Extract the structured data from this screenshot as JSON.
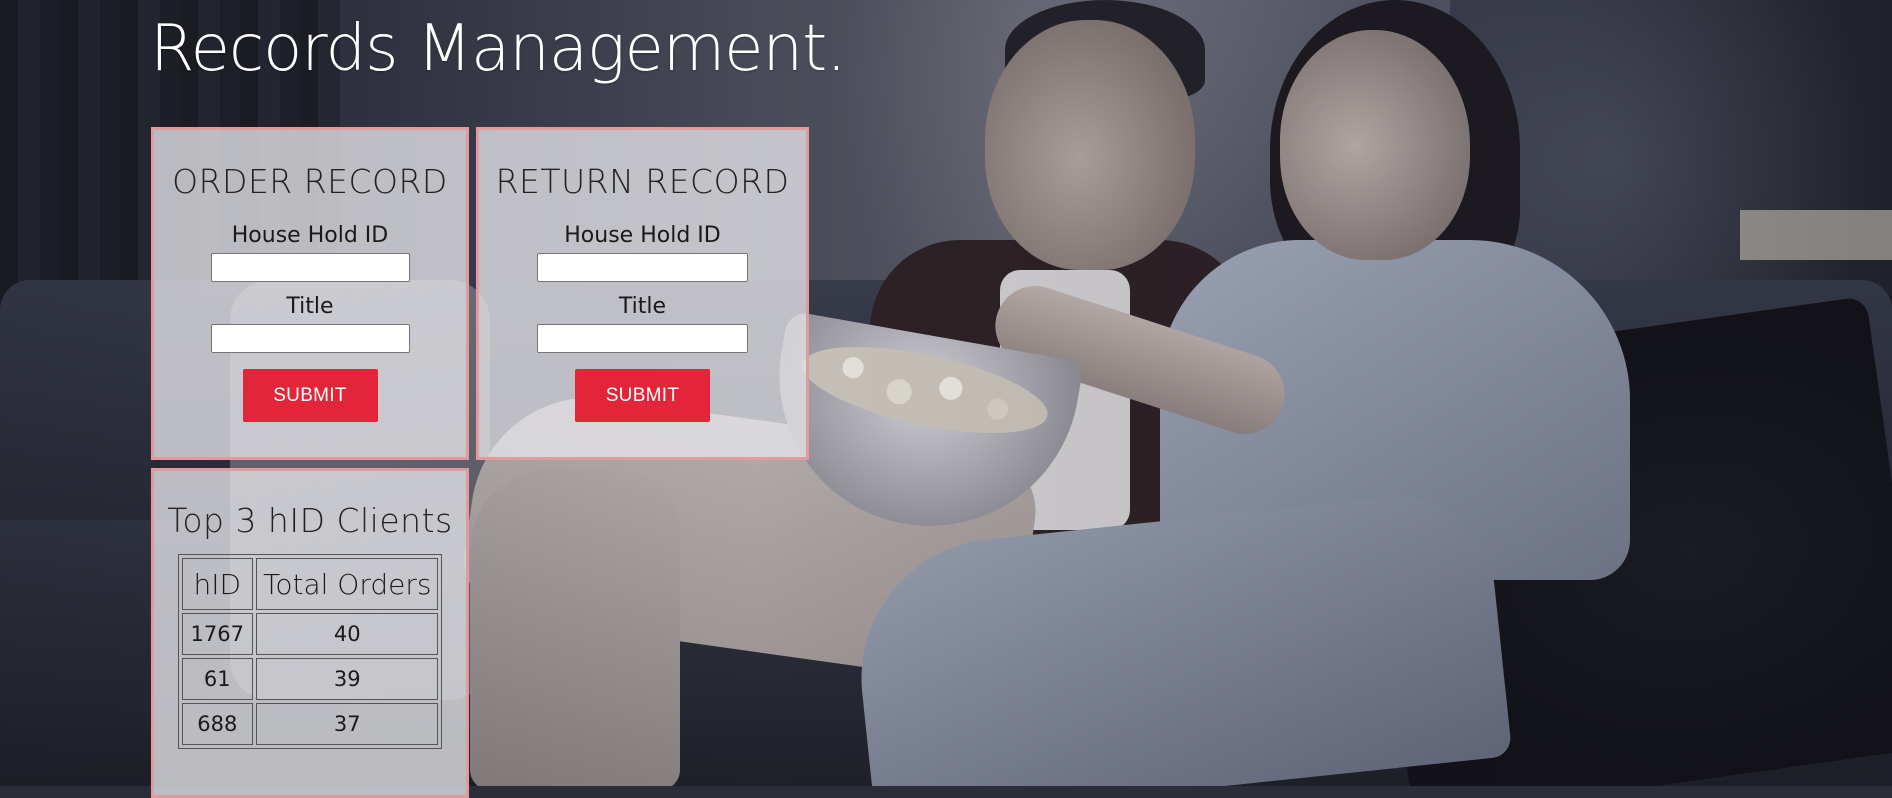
{
  "page": {
    "title": "Records Management."
  },
  "order_record": {
    "heading": "ORDER RECORD",
    "household_label": "House Hold ID",
    "household_value": "",
    "title_label": "Title",
    "title_value": "",
    "submit_label": "SUBMIT"
  },
  "return_record": {
    "heading": "RETURN RECORD",
    "household_label": "House Hold ID",
    "household_value": "",
    "title_label": "Title",
    "title_value": "",
    "submit_label": "SUBMIT"
  },
  "top_clients": {
    "heading": "Top 3 hID Clients",
    "columns": [
      "hID",
      "Total Orders"
    ],
    "rows": [
      [
        "1767",
        "40"
      ],
      [
        "61",
        "39"
      ],
      [
        "688",
        "37"
      ]
    ]
  },
  "colors": {
    "accent": "#e3253a",
    "card_border": "#e29a9c",
    "title_text": "#ffffff"
  }
}
